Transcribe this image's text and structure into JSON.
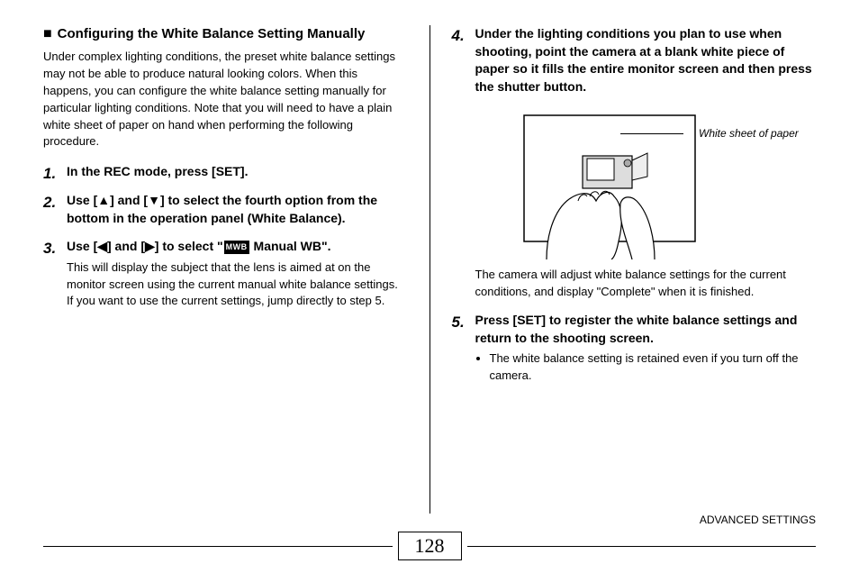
{
  "heading": "Configuring the White Balance Setting Manually",
  "intro": "Under complex lighting conditions, the preset white balance settings may not be able to produce natural looking colors. When this happens, you can configure the white balance setting manually for particular lighting conditions. Note that you will need to have a plain white sheet of paper on hand when performing the following procedure.",
  "steps_left": {
    "s1": {
      "num": "1.",
      "head": "In the REC mode, press [SET]."
    },
    "s2": {
      "num": "2.",
      "head": "Use [▲] and [▼] to select the fourth option from the bottom in the operation panel (White Balance)."
    },
    "s3": {
      "num": "3.",
      "head_pre": "Use [◀] and [▶] to select \"",
      "icon_label": "MWB",
      "head_post": " Manual WB\".",
      "body": "This will display the subject that the lens is aimed at on the monitor screen using the current manual white balance settings. If you want to use the current settings, jump directly to step 5."
    }
  },
  "steps_right": {
    "s4": {
      "num": "4.",
      "head": "Under the lighting conditions you plan to use when shooting, point the camera at a blank white piece of paper so it fills the entire monitor screen and then press the shutter button.",
      "body": "The camera will adjust white balance settings for the current conditions, and display \"Complete\" when it is finished."
    },
    "s5": {
      "num": "5.",
      "head": "Press [SET] to register the white balance settings and return to the shooting screen.",
      "note": "The white balance setting is retained even if you turn off the camera."
    }
  },
  "illustration_caption": "White sheet of paper",
  "page_number": "128",
  "footer_label": "ADVANCED SETTINGS"
}
